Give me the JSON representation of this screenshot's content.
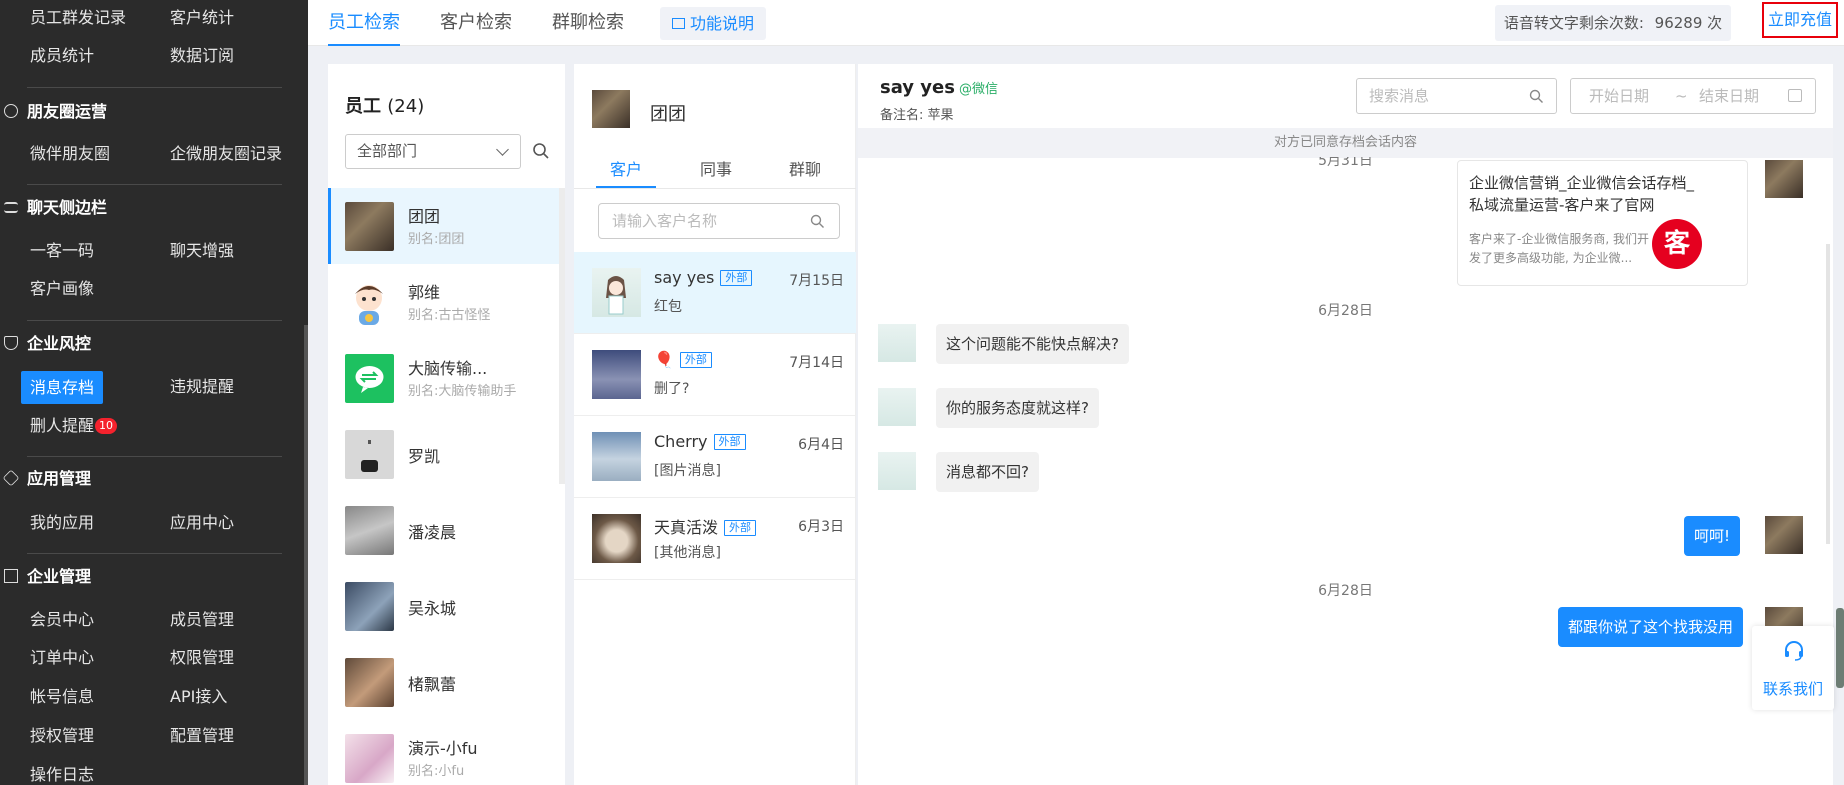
{
  "sidebar": {
    "row0": [
      "员工群发记录",
      "客户统计"
    ],
    "row1": [
      "成员统计",
      "数据订阅"
    ],
    "sec_moments": "朋友圈运营",
    "row2": [
      "微伴朋友圈",
      "企微朋友圈记录"
    ],
    "sec_chatbar": "聊天侧边栏",
    "row3": [
      "一客一码",
      "聊天增强"
    ],
    "row4": [
      "客户画像"
    ],
    "sec_risk": "企业风控",
    "row5": [
      "消息存档",
      "违规提醒"
    ],
    "row6": [
      "删人提醒"
    ],
    "delete_badge": "10",
    "sec_apps": "应用管理",
    "row7": [
      "我的应用",
      "应用中心"
    ],
    "sec_corp": "企业管理",
    "row8": [
      "会员中心",
      "成员管理"
    ],
    "row9": [
      "订单中心",
      "权限管理"
    ],
    "row10": [
      "帐号信息",
      "API接入"
    ],
    "row11": [
      "授权管理",
      "配置管理"
    ],
    "row12": [
      "操作日志"
    ]
  },
  "topbar": {
    "tabs": [
      "员工检索",
      "客户检索",
      "群聊检索"
    ],
    "func_label": "功能说明",
    "quota_label": "语音转文字剩余次数:",
    "quota_value": "96289 次",
    "recharge": "立即充值"
  },
  "employees": {
    "title": "员工",
    "count": "(24)",
    "dept": "全部部门",
    "list": [
      {
        "name": "团团",
        "alias": "别名:团团"
      },
      {
        "name": "郭维",
        "alias": "别名:古古怪怪"
      },
      {
        "name": "大脑传输...",
        "alias": "别名:大脑传输助手"
      },
      {
        "name": "罗凯",
        "alias": ""
      },
      {
        "name": "潘凌晨",
        "alias": ""
      },
      {
        "name": "吴永城",
        "alias": ""
      },
      {
        "name": "楮飘蕾",
        "alias": ""
      },
      {
        "name": "演示-小fu",
        "alias": "别名:小fu"
      }
    ]
  },
  "customers": {
    "owner": "团团",
    "tabs": [
      "客户",
      "同事",
      "群聊"
    ],
    "search_placeholder": "请输入客户名称",
    "ext_tag": "外部",
    "list": [
      {
        "name": "say yes",
        "date": "7月15日",
        "msg": "红包"
      },
      {
        "name": "🎈",
        "date": "7月14日",
        "msg": "删了?"
      },
      {
        "name": "Cherry",
        "date": "6月4日",
        "msg": "[图片消息]"
      },
      {
        "name": "天真活泼",
        "date": "6月3日",
        "msg": "[其他消息]"
      }
    ]
  },
  "chat": {
    "name": "say yes",
    "source": "@微信",
    "note": "备注名: 苹果",
    "search_placeholder": "搜索消息",
    "start_date": "开始日期",
    "tilde": "~",
    "end_date": "结束日期",
    "consent": "对方已同意存档会话内容",
    "date_top": "5月31日",
    "card_title": "企业微信营销_企业微信会话存档_私域流量运营-客户来了官网",
    "card_desc": "客户来了-企业微信服务商, 我们开发了更多高级功能, 为企业微...",
    "card_logo": "客",
    "date_mid": "6月28日",
    "msg1": "这个问题能不能快点解决?",
    "msg2": "你的服务态度就这样?",
    "msg3": "消息都不回?",
    "msg4": "呵呵!",
    "date_bottom": "6月28日",
    "msg5": "都跟你说了这个找我没用",
    "contact": "联系我们"
  }
}
